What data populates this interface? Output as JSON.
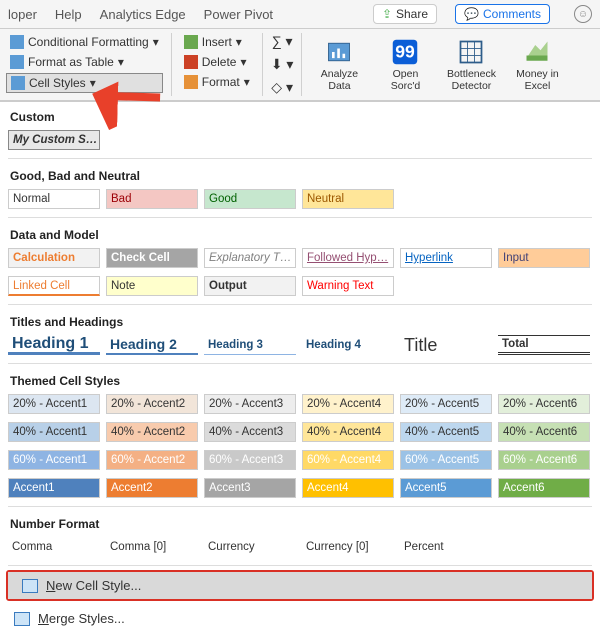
{
  "tabs": {
    "t1": "loper",
    "t2": "Help",
    "t3": "Analytics Edge",
    "t4": "Power Pivot"
  },
  "share": "Share",
  "comments": "Comments",
  "ribbon": {
    "condFmt": "Conditional Formatting",
    "fmtTable": "Format as Table",
    "cellStyles": "Cell Styles",
    "insert": "Insert",
    "delete": "Delete",
    "format": "Format",
    "analyze": "Analyze Data",
    "sorcd": "Open Sorc'd",
    "bottleneck": "Bottleneck Detector",
    "money": "Money in Excel"
  },
  "sections": {
    "custom": "Custom",
    "customItem": "My Custom S…",
    "gbn": "Good, Bad and Neutral",
    "gbnRow": {
      "normal": "Normal",
      "bad": "Bad",
      "good": "Good",
      "neutral": "Neutral"
    },
    "dm": "Data and Model",
    "dmRow1": {
      "calc": "Calculation",
      "check": "Check Cell",
      "expl": "Explanatory T…",
      "fhyp": "Followed Hyp…",
      "hyp": "Hyperlink",
      "input": "Input"
    },
    "dmRow2": {
      "linked": "Linked Cell",
      "note": "Note",
      "output": "Output",
      "warn": "Warning Text"
    },
    "th": "Titles and Headings",
    "thRow": {
      "h1": "Heading 1",
      "h2": "Heading 2",
      "h3": "Heading 3",
      "h4": "Heading 4",
      "title": "Title",
      "total": "Total"
    },
    "themed": "Themed Cell Styles",
    "accentRows": {
      "p20": {
        "a1": "20% - Accent1",
        "a2": "20% - Accent2",
        "a3": "20% - Accent3",
        "a4": "20% - Accent4",
        "a5": "20% - Accent5",
        "a6": "20% - Accent6"
      },
      "p40": {
        "a1": "40% - Accent1",
        "a2": "40% - Accent2",
        "a3": "40% - Accent3",
        "a4": "40% - Accent4",
        "a5": "40% - Accent5",
        "a6": "40% - Accent6"
      },
      "p60": {
        "a1": "60% - Accent1",
        "a2": "60% - Accent2",
        "a3": "60% - Accent3",
        "a4": "60% - Accent4",
        "a5": "60% - Accent5",
        "a6": "60% - Accent6"
      },
      "full": {
        "a1": "Accent1",
        "a2": "Accent2",
        "a3": "Accent3",
        "a4": "Accent4",
        "a5": "Accent5",
        "a6": "Accent6"
      }
    },
    "nf": "Number Format",
    "nfRow": {
      "comma": "Comma",
      "comma0": "Comma [0]",
      "curr": "Currency",
      "curr0": "Currency [0]",
      "pct": "Percent"
    },
    "newStyle": "New Cell Style...",
    "merge": "Merge Styles..."
  },
  "colors": {
    "bad": "#f4c7c3",
    "good": "#c6e7ce",
    "neutral": "#ffe699",
    "calc": "#ed7d31",
    "check": "#a5a5a5",
    "note": "#ffffcc",
    "input": "#ffcc99",
    "a1_20": "#dce6f1",
    "a2_20": "#f2e5d9",
    "a3_20": "#ededed",
    "a4_20": "#fff2cc",
    "a5_20": "#deebf7",
    "a6_20": "#e2efda",
    "a1_40": "#b8d0e8",
    "a2_40": "#f8cbad",
    "a3_40": "#dbdbdb",
    "a4_40": "#ffe699",
    "a5_40": "#bdd7ee",
    "a6_40": "#c6e0b4",
    "a1_60": "#8eb4e3",
    "a2_60": "#f4b084",
    "a3_60": "#c9c9c9",
    "a4_60": "#ffd966",
    "a5_60": "#9bc2e6",
    "a6_60": "#a9d08e",
    "a1": "#4f81bd",
    "a2": "#ed7d31",
    "a3": "#a5a5a5",
    "a4": "#ffc000",
    "a5": "#5b9bd5",
    "a6": "#70ad47"
  }
}
